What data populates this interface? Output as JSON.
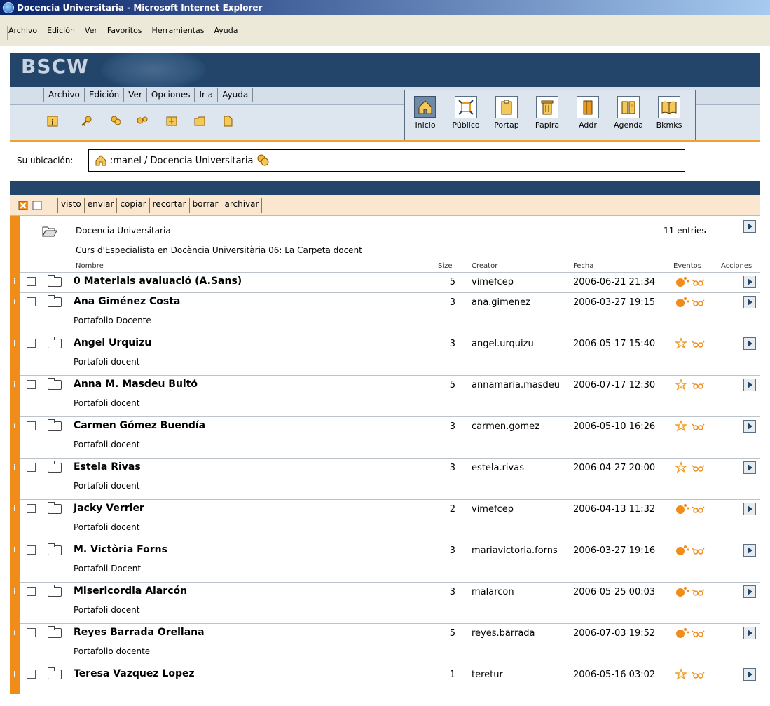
{
  "window_title": "Docencia Universitaria - Microsoft Internet Explorer",
  "ie_menu": [
    "Archivo",
    "Edición",
    "Ver",
    "Favoritos",
    "Herramientas",
    "Ayuda"
  ],
  "bscw_logo": "BSCW",
  "bscw_menu": [
    "Archivo",
    "Edición",
    "Ver",
    "Opciones",
    "Ir a",
    "Ayuda"
  ],
  "big_tools": [
    {
      "label": "Inicio",
      "icon": "home-icon",
      "selected": true
    },
    {
      "label": "Público",
      "icon": "public-icon",
      "selected": false
    },
    {
      "label": "Portap",
      "icon": "clipboard-icon",
      "selected": false
    },
    {
      "label": "Paplra",
      "icon": "trash-icon",
      "selected": false
    },
    {
      "label": "Addr",
      "icon": "address-book-icon",
      "selected": false
    },
    {
      "label": "Agenda",
      "icon": "calendar-icon",
      "selected": false
    },
    {
      "label": "Bkmks",
      "icon": "bookmarks-icon",
      "selected": false
    }
  ],
  "location": {
    "label": "Su ubicación:",
    "path": ":manel / Docencia Universitaria"
  },
  "actions": [
    "visto",
    "enviar",
    "copiar",
    "recortar",
    "borrar",
    "archivar"
  ],
  "folder": {
    "name": "Docencia Universitaria",
    "description": "Curs d'Especialista en Docència Universitària 06: La Carpeta docent",
    "entries": "11 entries"
  },
  "columns": {
    "name": "Nombre",
    "size": "Size",
    "creator": "Creator",
    "date": "Fecha",
    "events": "Eventos",
    "actions": "Acciones"
  },
  "rows": [
    {
      "name": "0 Materials avaluació (A.Sans)",
      "desc": "",
      "size": "5",
      "creator": "vimefcep",
      "date": "2006-06-21 21:34",
      "event": "new"
    },
    {
      "name": "Ana Giménez Costa",
      "desc": "Portafolio Docente",
      "size": "3",
      "creator": "ana.gimenez",
      "date": "2006-03-27 19:15",
      "event": "new"
    },
    {
      "name": "Angel Urquizu",
      "desc": "Portafoli docent",
      "size": "3",
      "creator": "angel.urquizu",
      "date": "2006-05-17 15:40",
      "event": "star"
    },
    {
      "name": "Anna M. Masdeu Bultó",
      "desc": "Portafoli docent",
      "size": "5",
      "creator": "annamaria.masdeu",
      "date": "2006-07-17 12:30",
      "event": "star"
    },
    {
      "name": "Carmen Gómez Buendía",
      "desc": "Portafoli docent",
      "size": "3",
      "creator": "carmen.gomez",
      "date": "2006-05-10 16:26",
      "event": "star"
    },
    {
      "name": "Estela Rivas",
      "desc": "Portafoli docent",
      "size": "3",
      "creator": "estela.rivas",
      "date": "2006-04-27 20:00",
      "event": "star"
    },
    {
      "name": "Jacky Verrier",
      "desc": "Portafoli docent",
      "size": "2",
      "creator": "vimefcep",
      "date": "2006-04-13 11:32",
      "event": "new"
    },
    {
      "name": "M. Victòria Forns",
      "desc": "Portafoli Docent",
      "size": "3",
      "creator": "mariavictoria.forns",
      "date": "2006-03-27 19:16",
      "event": "new"
    },
    {
      "name": "Misericordia Alarcón",
      "desc": "Portafoli docent",
      "size": "3",
      "creator": "malarcon",
      "date": "2006-05-25 00:03",
      "event": "new"
    },
    {
      "name": "Reyes Barrada Orellana",
      "desc": "Portafolio docente",
      "size": "5",
      "creator": "reyes.barrada",
      "date": "2006-07-03 19:52",
      "event": "new"
    },
    {
      "name": "Teresa Vazquez Lopez",
      "desc": "",
      "size": "1",
      "creator": "teretur",
      "date": "2006-05-16 03:02",
      "event": "star"
    }
  ],
  "colors": {
    "accent": "#f08c1a",
    "banner": "#23456a",
    "actionbar": "#fbe7cf"
  }
}
